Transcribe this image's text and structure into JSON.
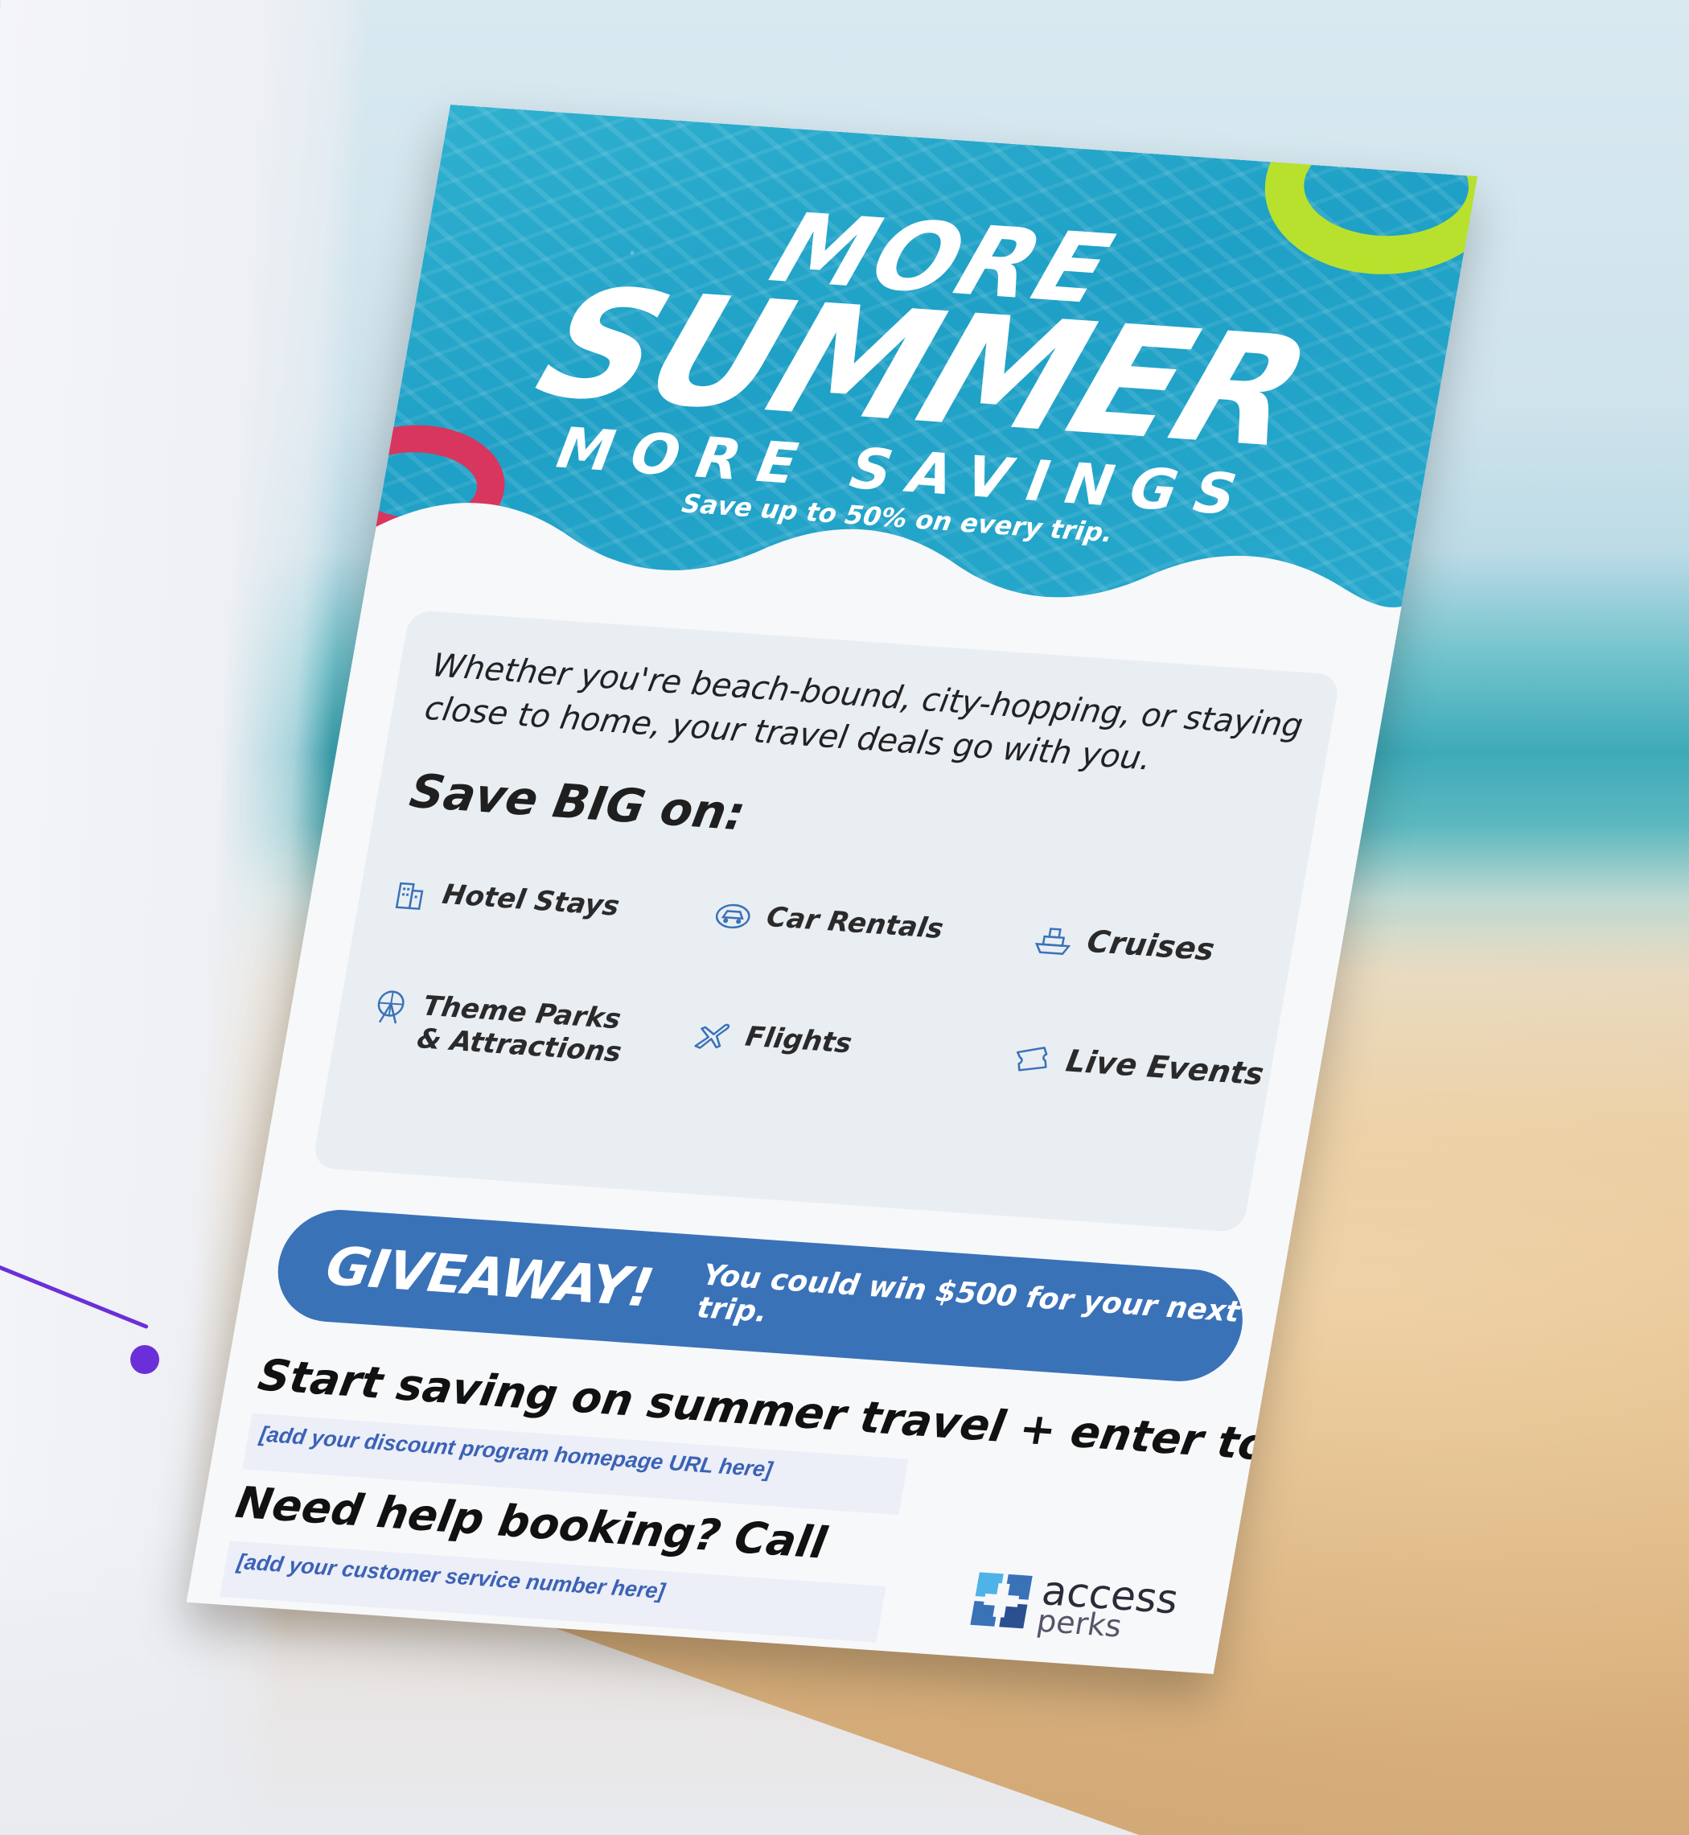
{
  "headline": {
    "line1": "MORE",
    "line2": "SUMMER",
    "line3": "MORE SAVINGS",
    "tagline": "Save up to 50% on every trip."
  },
  "intro": "Whether you're beach-bound, city-hopping, or staying close to home, your travel deals go with you.",
  "save_big_heading": "Save BIG on:",
  "benefits": [
    {
      "label": "Hotel Stays",
      "icon": "hotel-icon"
    },
    {
      "label": "Car Rentals",
      "icon": "car-icon"
    },
    {
      "label": "Cruises",
      "icon": "cruise-ship-icon"
    },
    {
      "label": "Theme Parks & Attractions",
      "icon": "ferris-wheel-icon"
    },
    {
      "label": "Flights",
      "icon": "airplane-icon"
    },
    {
      "label": "Live Events",
      "icon": "ticket-icon"
    }
  ],
  "giveaway": {
    "title": "GIVEAWAY!",
    "text": "You could win $500 for your next trip."
  },
  "cta": {
    "start_text": "Start saving on summer travel + enter to win at",
    "url_placeholder": "[add your discount program homepage URL here]",
    "help_text": "Need help booking? Call",
    "phone_placeholder": "[add your customer service number here]"
  },
  "logo": {
    "line1": "access",
    "line2": "perks"
  },
  "colors": {
    "pool": "#1fa0c6",
    "giveaway_band": "#3a72b8",
    "pointer": "#6b2fd9",
    "pink_float": "#d8365e",
    "green_float": "#b7e12c"
  }
}
